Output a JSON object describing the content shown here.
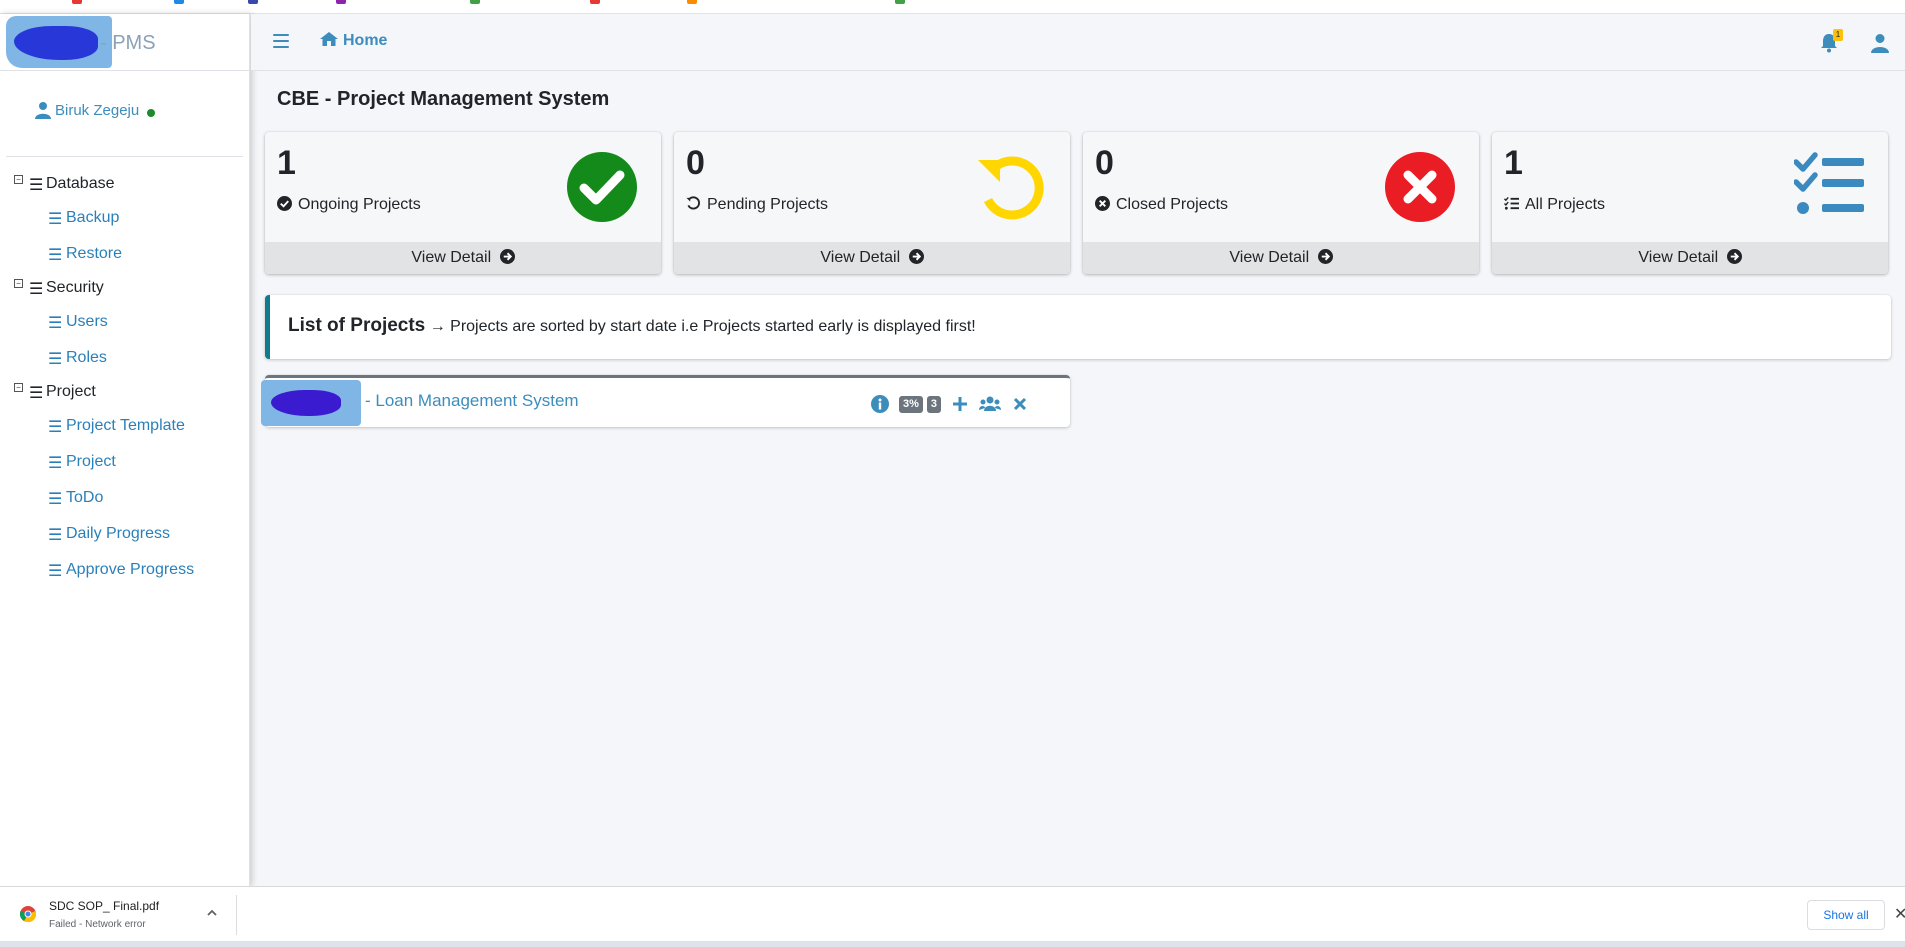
{
  "colors": {
    "accent": "#3c8dbc",
    "ongoing": "#138a19",
    "pending": "#ffd600",
    "closed": "#ea1c24",
    "all": "#3a8ac0",
    "callout_border": "#117a8b"
  },
  "brand": {
    "suffix": "- PMS"
  },
  "sidebar": {
    "user": {
      "name": "Biruk Zegeju"
    },
    "groups": [
      {
        "label": "Database",
        "items": [
          {
            "label": "Backup"
          },
          {
            "label": "Restore"
          }
        ]
      },
      {
        "label": "Security",
        "items": [
          {
            "label": "Users"
          },
          {
            "label": "Roles"
          }
        ]
      },
      {
        "label": "Project",
        "items": [
          {
            "label": "Project Template"
          },
          {
            "label": "Project"
          },
          {
            "label": "ToDo"
          },
          {
            "label": "Daily Progress"
          },
          {
            "label": "Approve Progress"
          }
        ]
      }
    ]
  },
  "navbar": {
    "home_label": "Home",
    "notification_count": "1"
  },
  "main": {
    "title": "CBE - Project Management System",
    "stats": [
      {
        "count": "1",
        "label": "Ongoing Projects",
        "footer": "View Detail",
        "icon": "check-circle-icon"
      },
      {
        "count": "0",
        "label": "Pending Projects",
        "footer": "View Detail",
        "icon": "undo-icon"
      },
      {
        "count": "0",
        "label": "Closed Projects",
        "footer": "View Detail",
        "icon": "times-circle-icon"
      },
      {
        "count": "1",
        "label": "All Projects",
        "footer": "View Detail",
        "icon": "tasks-icon"
      }
    ],
    "callout": {
      "title": "List of Projects",
      "arrow": "→",
      "text": "Projects are sorted by start date i.e Projects started early is displayed first!"
    },
    "project": {
      "name": "- Loan Management System",
      "progress_badge": "3%",
      "count_badge": "3"
    }
  },
  "download": {
    "file_name": "SDC SOP_ Final.pdf",
    "status": "Failed - Network error",
    "show_all": "Show all",
    "close_glyph": "✕"
  }
}
